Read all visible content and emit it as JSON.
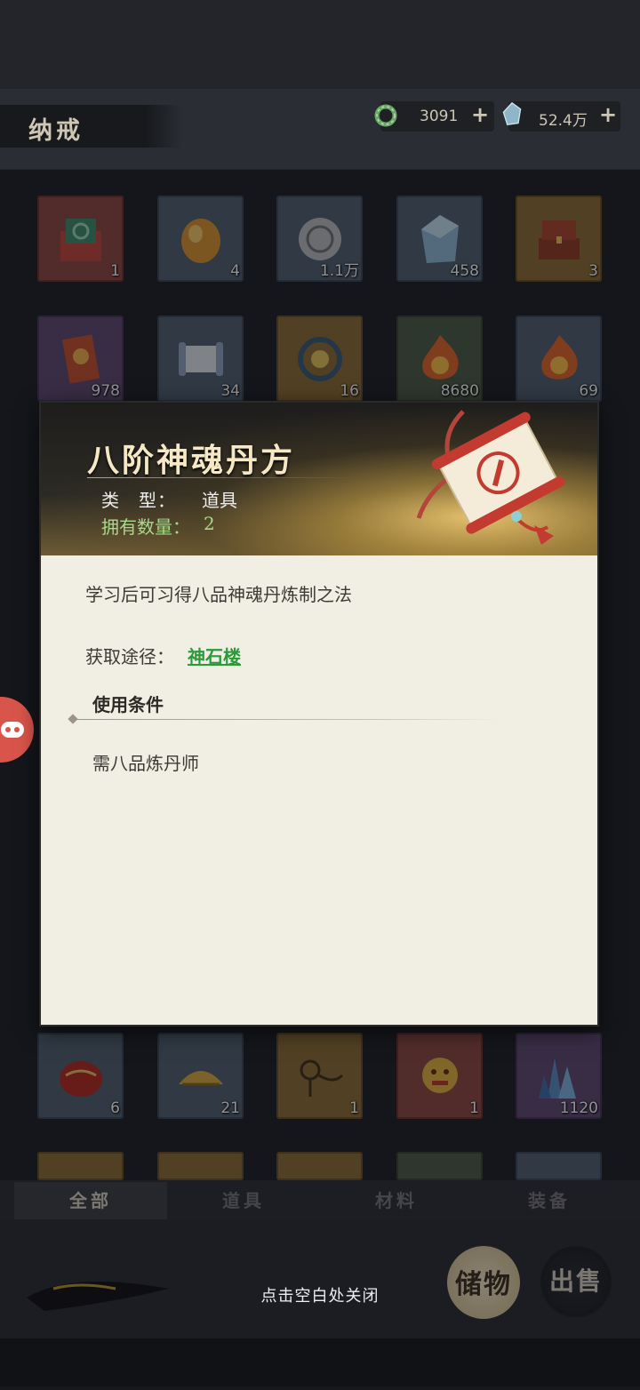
{
  "header": {
    "title": "纳戒",
    "resources": [
      {
        "icon": "jade-ring-icon",
        "value": "3091",
        "plus": "+"
      },
      {
        "icon": "spirit-stone-icon",
        "value": "52.4万",
        "plus": "+"
      }
    ]
  },
  "grid": {
    "row1": [
      {
        "icon": "gift-box-icon",
        "count": "1"
      },
      {
        "icon": "golden-egg-icon",
        "count": "4"
      },
      {
        "icon": "silver-coin-icon",
        "count": "1.1万"
      },
      {
        "icon": "blue-crystal-icon",
        "count": "458"
      },
      {
        "icon": "treasure-chest-icon",
        "count": "3"
      }
    ],
    "row2": [
      {
        "icon": "talisman-icon",
        "count": "978"
      },
      {
        "icon": "scroll-icon",
        "count": "34"
      },
      {
        "icon": "dragon-emblem-icon",
        "count": "16"
      },
      {
        "icon": "fire-orb-icon",
        "count": "8680"
      },
      {
        "icon": "fire-orb-icon",
        "count": "69"
      }
    ],
    "row3": [
      {
        "icon": "red-seed-icon",
        "count": "6"
      },
      {
        "icon": "golden-comb-icon",
        "count": "21"
      },
      {
        "icon": "golden-ornament-icon",
        "count": "1"
      },
      {
        "icon": "golden-lion-icon",
        "count": "1"
      },
      {
        "icon": "crystal-cluster-icon",
        "count": "1120"
      }
    ]
  },
  "tabs": {
    "all": "全部",
    "items": "道具",
    "materials": "材料",
    "equipment": "装备"
  },
  "footer": {
    "close_hint": "点击空白处关闭",
    "storage_button": "储物",
    "sell_button": "出售"
  },
  "detail": {
    "name": "八阶神魂丹方",
    "type_label": "类　型：",
    "type_value": "道具",
    "count_label": "拥有数量：",
    "count_value": "2",
    "description": "学习后可习得八品神魂丹炼制之法",
    "source_label": "获取途径：",
    "source_link": "神石楼",
    "conditions_title": "使用条件",
    "condition": "需八品炼丹师"
  }
}
